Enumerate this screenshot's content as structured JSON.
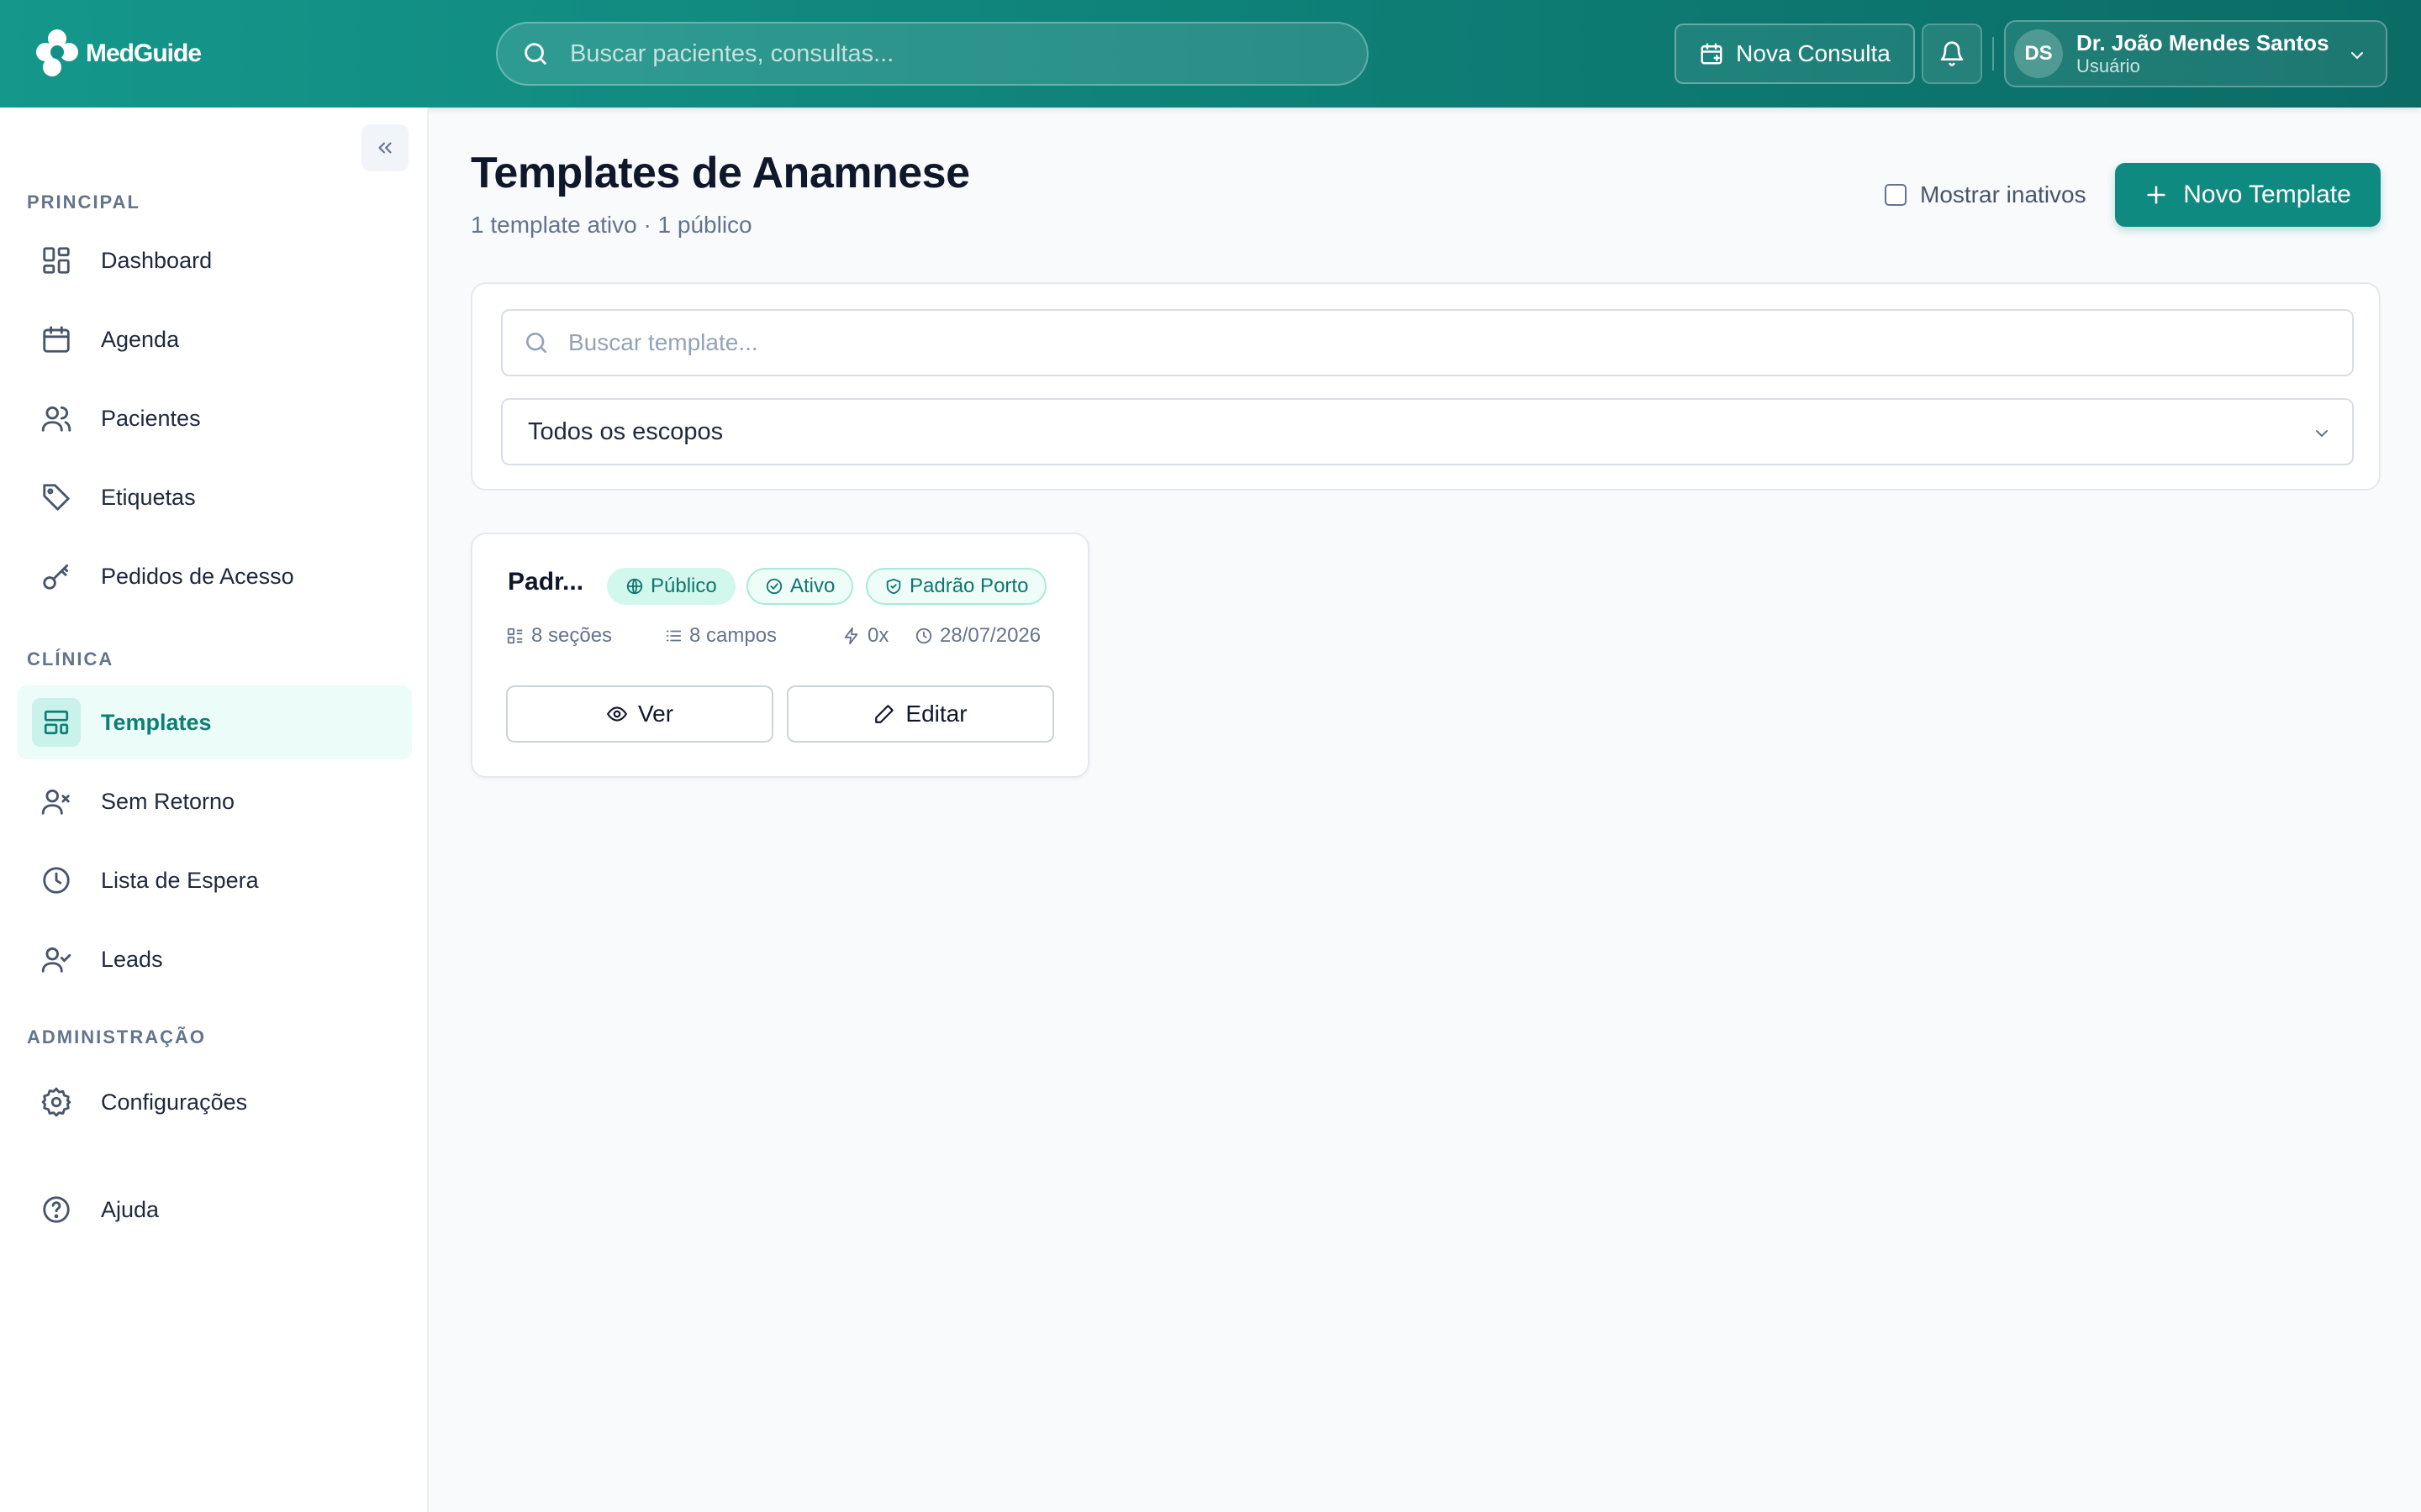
{
  "app": {
    "name": "MedGuide"
  },
  "header": {
    "search_placeholder": "Buscar pacientes, consultas...",
    "new_consult_label": "Nova Consulta",
    "user": {
      "initials": "DS",
      "name": "Dr. João Mendes Santos",
      "role": "Usuário"
    }
  },
  "sidebar": {
    "sections": [
      {
        "label": "PRINCIPAL"
      },
      {
        "label": "CLÍNICA"
      },
      {
        "label": "ADMINISTRAÇÃO"
      }
    ],
    "items": [
      {
        "label": "Dashboard",
        "icon": "dashboard-icon"
      },
      {
        "label": "Agenda",
        "icon": "calendar-icon"
      },
      {
        "label": "Pacientes",
        "icon": "users-icon"
      },
      {
        "label": "Etiquetas",
        "icon": "tag-icon"
      },
      {
        "label": "Pedidos de Acesso",
        "icon": "key-icon"
      },
      {
        "label": "Templates",
        "icon": "layout-template-icon",
        "active": true
      },
      {
        "label": "Sem Retorno",
        "icon": "user-x-icon"
      },
      {
        "label": "Lista de Espera",
        "icon": "clock-icon"
      },
      {
        "label": "Leads",
        "icon": "user-check-icon"
      },
      {
        "label": "Configurações",
        "icon": "settings-icon"
      },
      {
        "label": "Ajuda",
        "icon": "help-circle-icon"
      }
    ]
  },
  "main": {
    "title": "Templates de Anamnese",
    "subtitle": "1 template ativo · 1 público",
    "show_inactive_label": "Mostrar inativos",
    "show_inactive_checked": false,
    "new_template_label": "Novo Template",
    "search_placeholder": "Buscar template...",
    "scope_select_value": "Todos os escopos",
    "templates": [
      {
        "name": "Padr...",
        "badges": [
          "Público",
          "Ativo",
          "Padrão Porto"
        ],
        "sections": "8 seções",
        "fields": "8 campos",
        "uses": "0x",
        "date": "28/07/2026",
        "view_label": "Ver",
        "edit_label": "Editar"
      }
    ]
  },
  "colors": {
    "brand": "#0f8a80",
    "brand_light": "#ecfdf9",
    "badge_text": "#0f766e"
  }
}
